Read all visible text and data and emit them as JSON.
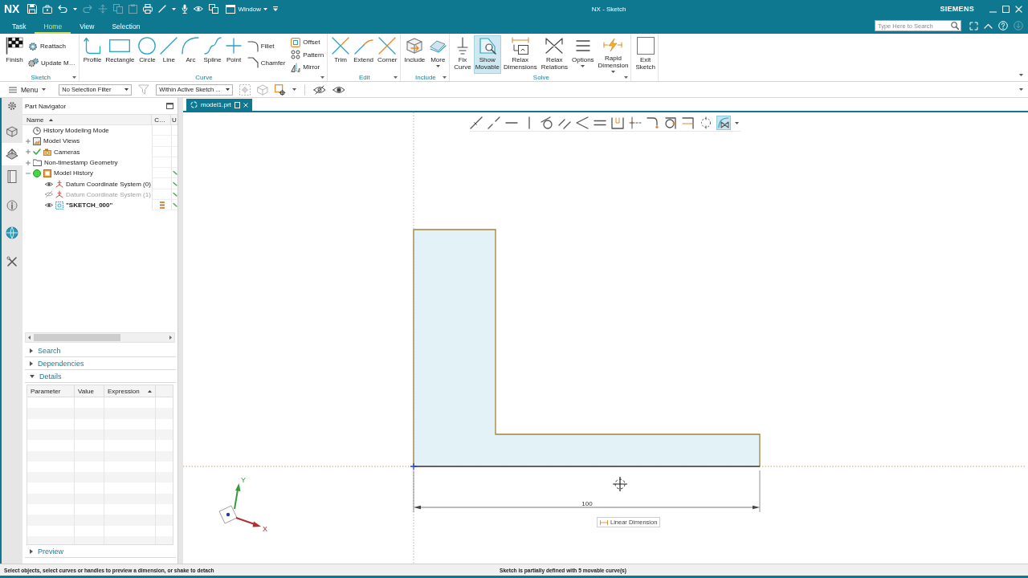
{
  "window": {
    "logo": "NX",
    "title": "NX - Sketch",
    "brand": "SIEMENS"
  },
  "quick_access": {
    "buttons": [
      {
        "disabled": false
      },
      {
        "disabled": false
      },
      {
        "disabled": false
      },
      {
        "disabled": true
      },
      {
        "disabled": true
      },
      {
        "disabled": true
      },
      {
        "disabled": true
      },
      {
        "disabled": false
      },
      {
        "disabled": false
      },
      {
        "disabled": false
      },
      {
        "disabled": false
      },
      {
        "disabled": false
      }
    ],
    "window_menu": "Window"
  },
  "tabs": [
    {
      "label": "Task",
      "selected": false
    },
    {
      "label": "Home",
      "selected": true
    },
    {
      "label": "View",
      "selected": false
    },
    {
      "label": "Selection",
      "selected": false
    }
  ],
  "search": {
    "placeholder": "Type Here to Search"
  },
  "ribbon": {
    "groups": [
      {
        "label": "Sketch",
        "dropdown": true,
        "items": [
          {
            "kind": "large",
            "label": "Finish",
            "on": false
          },
          {
            "kind": "stack",
            "items": [
              {
                "label": "Reattach"
              },
              {
                "label": "Update M…"
              }
            ]
          }
        ]
      },
      {
        "label": "Curve",
        "dropdown": true,
        "items": [
          {
            "kind": "large",
            "label": "Profile",
            "on": false
          },
          {
            "kind": "large",
            "label": "Rectangle",
            "on": false
          },
          {
            "kind": "large",
            "label": "Circle",
            "on": false
          },
          {
            "kind": "large",
            "label": "Line",
            "on": false
          },
          {
            "kind": "large",
            "label": "Arc",
            "on": false
          },
          {
            "kind": "large",
            "label": "Spline",
            "on": false
          },
          {
            "kind": "large",
            "label": "Point",
            "on": false
          },
          {
            "kind": "stack",
            "items": [
              {
                "label": "Fillet"
              },
              {
                "label": "Chamfer"
              }
            ]
          },
          {
            "kind": "stack",
            "items": [
              {
                "label": "Offset"
              },
              {
                "label": "Pattern"
              },
              {
                "label": "Mirror"
              }
            ]
          }
        ]
      },
      {
        "label": "Edit",
        "dropdown": true,
        "items": [
          {
            "kind": "large",
            "label": "Trim",
            "on": false
          },
          {
            "kind": "large",
            "label": "Extend",
            "on": false
          },
          {
            "kind": "large",
            "label": "Corner",
            "on": false
          }
        ]
      },
      {
        "label": "Include",
        "dropdown": true,
        "items": [
          {
            "kind": "large",
            "label": "Include",
            "on": false
          },
          {
            "kind": "large",
            "label": "More",
            "on": false,
            "dropdown": true
          }
        ]
      },
      {
        "label": "Solve",
        "dropdown": true,
        "items": [
          {
            "kind": "large",
            "label": "Fix Curve",
            "on": false
          },
          {
            "kind": "large",
            "label": "Show Movable",
            "on": true
          },
          {
            "kind": "large",
            "label": "Relax Dimensions",
            "on": false
          },
          {
            "kind": "large",
            "label": "Relax Relations",
            "on": false
          },
          {
            "kind": "large",
            "label": "Options",
            "on": false,
            "dropdown": true
          },
          {
            "kind": "large",
            "label": "Rapid Dimension",
            "on": false,
            "dropdown": true
          }
        ]
      },
      {
        "items": [
          {
            "kind": "large",
            "label": "Exit Sketch",
            "on": false
          }
        ]
      }
    ]
  },
  "selection_bar": {
    "menu": "Menu",
    "filter": "No Selection Filter",
    "scope": "Within Active Sketch ...",
    "buttons": [
      {
        "disabled": true
      },
      {
        "disabled": true
      },
      {
        "disabled": true
      },
      {
        "disabled": false
      },
      {
        "disabled": false
      },
      {
        "disabled": false
      }
    ]
  },
  "resource_bar": {
    "tabs": [
      {
        "selected": false
      },
      {
        "selected": false
      },
      {
        "selected": true
      },
      {
        "selected": false
      },
      {
        "selected": false
      },
      {
        "selected": false
      },
      {
        "selected": false
      }
    ]
  },
  "part_navigator": {
    "title": "Part Navigator",
    "columns": [
      "Name",
      "C…",
      "U"
    ],
    "tree": [
      {
        "label": "History Modeling Mode",
        "up_to_date": false
      },
      {
        "label": "Model Views",
        "expanded": false,
        "up_to_date": false
      },
      {
        "label": "Cameras",
        "expanded": false,
        "up_to_date": false
      },
      {
        "label": "Non-timestamp Geometry",
        "expanded": false,
        "up_to_date": false
      },
      {
        "label": "Model History",
        "expanded": true,
        "up_to_date": true,
        "children": [
          {
            "label": "Datum Coordinate System (0)",
            "visible": true,
            "current": false,
            "up_to_date": true
          },
          {
            "label": "Datum Coordinate System (1)",
            "visible": false,
            "current": false,
            "up_to_date": true
          },
          {
            "label": "\"SKETCH_000\"",
            "visible": true,
            "current": true,
            "up_to_date": true
          }
        ]
      }
    ],
    "sections": [
      {
        "label": "Search",
        "expanded": false
      },
      {
        "label": "Dependencies",
        "expanded": false
      },
      {
        "label": "Details",
        "expanded": true,
        "columns": [
          "Parameter",
          "Value",
          "Expression"
        ]
      },
      {
        "label": "Preview",
        "expanded": false
      }
    ]
  },
  "document_tabs": [
    {
      "label": "model1.prt",
      "selected": true
    }
  ],
  "sketch_toolbar": {
    "buttons": [
      {
        "on": false
      },
      {
        "on": false
      },
      {
        "on": false
      },
      {
        "on": false
      },
      {
        "on": false
      },
      {
        "on": false
      },
      {
        "on": false
      },
      {
        "on": false
      },
      {
        "on": false
      },
      {
        "on": false
      },
      {
        "on": false
      },
      {
        "on": false
      },
      {
        "on": false
      },
      {
        "on": false
      },
      {
        "on": true
      }
    ]
  },
  "canvas": {
    "dimension": "100",
    "tooltip": "Linear Dimension",
    "axis_labels": [
      "X",
      "Y"
    ]
  },
  "status_bar": {
    "prompt": "Select objects, select curves or handles to preview a dimension, or shake to detach",
    "status": "Sketch is partially defined with 5 movable curve(s)"
  }
}
